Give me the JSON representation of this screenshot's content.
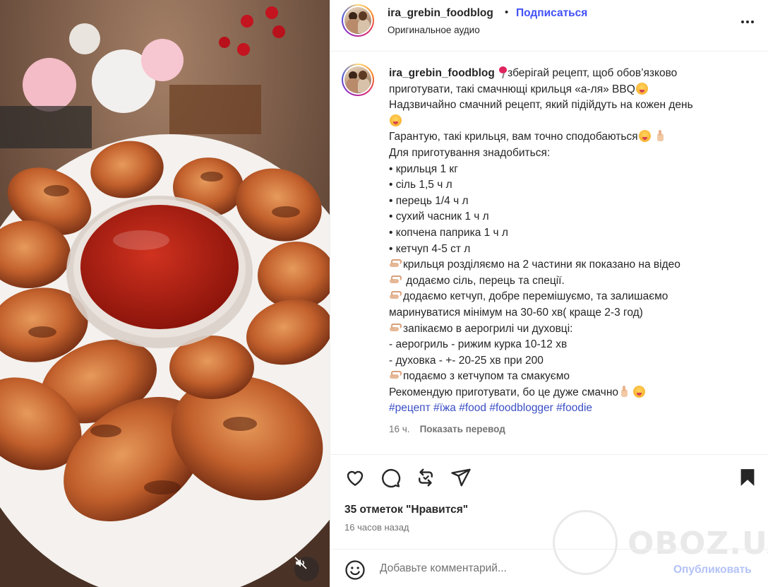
{
  "header": {
    "username": "ira_grebin_foodblog",
    "separator": "•",
    "follow_label": "Подписаться",
    "audio_label": "Оригинальное аудио",
    "more_icon": "more-horizontal-icon"
  },
  "caption": {
    "username": "ira_grebin_foodblog",
    "lines": [
      "зберігай рецепт, щоб обов’язково",
      "приготувати, такі смачнющі крильця «а-ля» BBQ",
      "Надзвичайно смачний рецепт, який підійдуть на кожен день",
      "",
      "Гарантую, такі крильця, вам точно сподобаються",
      "Для приготування знадобиться:",
      "• крильця 1 кг",
      "• сіль 1,5 ч л",
      "• перець 1/4 ч л",
      "• сухий часник 1 ч л",
      "• копчена паприка 1 ч л",
      "• кетчуп 4-5 ст л",
      "крильця розділяємо на 2 частини як показано на відео",
      " додаємо сіль, перець та спеції.",
      "додаємо кетчуп, добре перемішуємо, та залишаємо",
      "маринуватися мінімум на 30-60 хв( краще 2-3 год)",
      "запікаємо в аерогрилі чи духовці:",
      "- аерогриль - рижим курка 10-12 хв",
      "- духовка - +- 20-25 хв при 200",
      "подаємо з кетчупом та смакуємо",
      "Рекомендую приготувати, бо це дуже смачно"
    ],
    "hashtags": [
      "#рецепт",
      "#їжа",
      "#food",
      "#foodblogger",
      "#foodie"
    ],
    "time": "16 ч.",
    "translate_label": "Показать перевод"
  },
  "actions": {
    "like_icon": "heart-icon",
    "comment_icon": "comment-icon",
    "repost_icon": "repost-icon",
    "share_icon": "share-icon",
    "save_icon": "bookmark-icon"
  },
  "likes_text": "35 отметок \"Нравится\"",
  "posted_ago": "16 часов назад",
  "comment": {
    "placeholder": "Добавьте комментарий...",
    "publish_label": "Опубликовать",
    "emoji_icon": "smiley-icon"
  },
  "watermark": "OBOZ.UA",
  "video": {
    "mute_icon": "speaker-muted-icon"
  },
  "colors": {
    "accent_link": "#4150f7",
    "hashtag": "#3b4fc4",
    "publish_disabled": "#b3c2f7",
    "muted_text": "#737373"
  }
}
